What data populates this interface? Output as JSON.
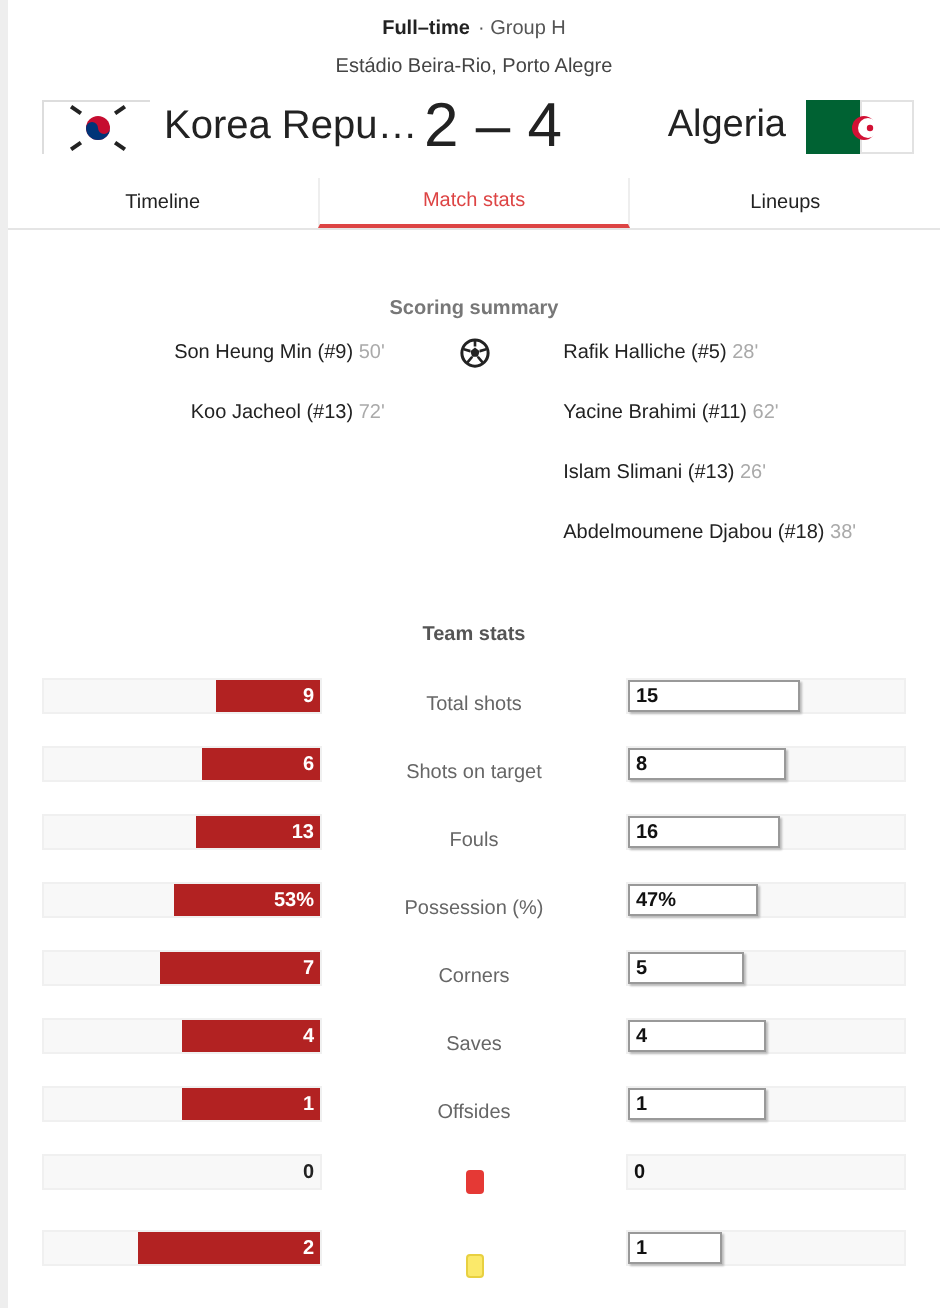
{
  "header": {
    "status": "Full–time",
    "group": "· Group H",
    "venue": "Estádio Beira-Rio, Porto Alegre"
  },
  "home": {
    "name": "Korea Repu…"
  },
  "score": "2 – 4",
  "away": {
    "name": "Algeria"
  },
  "tabs": [
    {
      "label": "Timeline",
      "selected": false
    },
    {
      "label": "Match stats",
      "selected": true
    },
    {
      "label": "Lineups",
      "selected": false
    }
  ],
  "scoring_summary": {
    "title": "Scoring summary",
    "home_goals": [
      {
        "player": "Son Heung Min (#9)",
        "minute": "50'"
      },
      {
        "player": "Koo Jacheol (#13)",
        "minute": "72'"
      }
    ],
    "away_goals": [
      {
        "player": "Rafik Halliche (#5)",
        "minute": "28'"
      },
      {
        "player": "Yacine Brahimi (#11)",
        "minute": "62'"
      },
      {
        "player": "Islam Slimani (#13)",
        "minute": "26'"
      },
      {
        "player": "Abdelmoumene Djabou (#18)",
        "minute": "38'"
      }
    ]
  },
  "team_stats": {
    "title": "Team stats",
    "rows": [
      {
        "kind": "text",
        "label": "Total shots",
        "home": {
          "value": "9",
          "level": 0.375
        },
        "away": {
          "value": "15",
          "level": 0.625
        }
      },
      {
        "kind": "text",
        "label": "Shots on target",
        "home": {
          "value": "6",
          "level": 0.43
        },
        "away": {
          "value": "8",
          "level": 0.57
        }
      },
      {
        "kind": "text",
        "label": "Fouls",
        "home": {
          "value": "13",
          "level": 0.45
        },
        "away": {
          "value": "16",
          "level": 0.55
        }
      },
      {
        "kind": "text",
        "label": "Possession (%)",
        "home": {
          "value": "53%",
          "level": 0.53
        },
        "away": {
          "value": "47%",
          "level": 0.47
        }
      },
      {
        "kind": "text",
        "label": "Corners",
        "home": {
          "value": "7",
          "level": 0.58
        },
        "away": {
          "value": "5",
          "level": 0.42
        }
      },
      {
        "kind": "text",
        "label": "Saves",
        "home": {
          "value": "4",
          "level": 0.5
        },
        "away": {
          "value": "4",
          "level": 0.5
        }
      },
      {
        "kind": "text",
        "label": "Offsides",
        "home": {
          "value": "1",
          "level": 0.5
        },
        "away": {
          "value": "1",
          "level": 0.5
        }
      },
      {
        "kind": "red_card",
        "home": {
          "value": "0"
        },
        "away": {
          "value": "0"
        }
      },
      {
        "kind": "yellow_card",
        "home": {
          "value": "2",
          "level": 0.66
        },
        "away": {
          "value": "1",
          "level": 0.34
        }
      }
    ]
  }
}
